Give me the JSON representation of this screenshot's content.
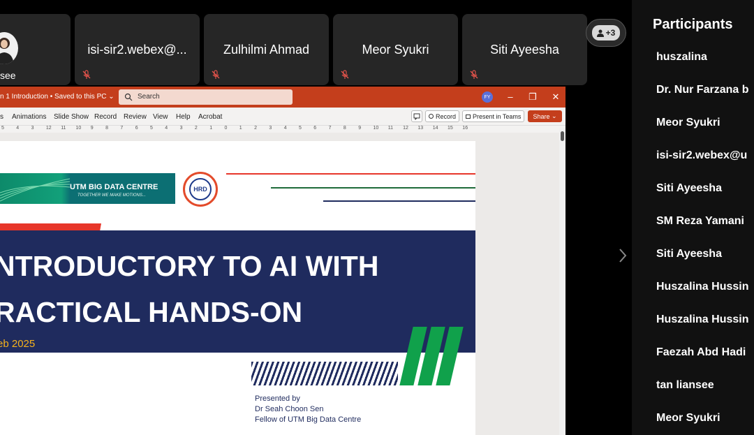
{
  "video_strip": {
    "tiles": [
      {
        "name": "see"
      },
      {
        "name": "isi-sir2.webex@..."
      },
      {
        "name": "Zulhilmi Ahmad"
      },
      {
        "name": "Meor Syukri"
      },
      {
        "name": "Siti Ayeesha"
      }
    ],
    "overflow_count": "+3"
  },
  "participants": {
    "title": "Participants",
    "items": [
      "huszalina",
      "Dr. Nur Farzana b",
      "Meor Syukri",
      "isi-sir2.webex@u",
      "Siti Ayeesha",
      "SM Reza Yamani",
      "Siti Ayeesha",
      "Huszalina Hussin",
      "Huszalina Hussin",
      "Faezah Abd Hadi",
      "tan liansee",
      "Meor Syukri"
    ]
  },
  "powerpoint": {
    "doc_title": "n 1 Introduction • Saved to this PC ⌄",
    "search_placeholder": "Search",
    "user_initials": "FY",
    "ribbon_tabs": [
      "s",
      "Animations",
      "Slide Show",
      "Record",
      "Review",
      "View",
      "Help",
      "Acrobat"
    ],
    "record_label": "Record",
    "present_label": "Present in Teams",
    "share_label": "Share",
    "ruler_labels": [
      "5",
      "4",
      "3",
      "12",
      "11",
      "10",
      "9",
      "8",
      "7",
      "6",
      "5",
      "4",
      "3",
      "2",
      "1",
      "0",
      "1",
      "2",
      "3",
      "4",
      "5",
      "6",
      "7",
      "8",
      "9",
      "10",
      "11",
      "12",
      "13",
      "14",
      "15",
      "16"
    ]
  },
  "slide": {
    "logo_text": "UTM BIG DATA CENTRE",
    "logo_tagline": "TOGETHER WE MAKE MOTIONS...",
    "hrd_text": "HRD",
    "title_line1": "NTRODUCTORY TO AI WITH",
    "title_line2": "RACTICAL HANDS-ON",
    "date": "eb 2025",
    "presented_by": "Presented by",
    "presenter": "Dr Seah Choon Sen",
    "role": "Fellow of UTM Big Data Centre",
    "colors": {
      "navy": "#1f2b5e",
      "red": "#e7362a",
      "green": "#10a14b",
      "accent_orange": "#f6b21b"
    }
  }
}
